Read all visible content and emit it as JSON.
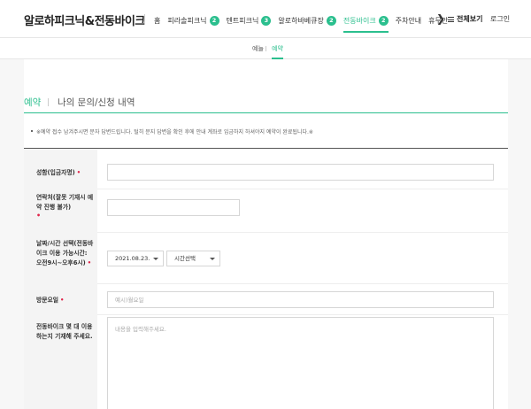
{
  "header": {
    "logo": "알로하피크닉&전동바이크",
    "nav": [
      {
        "label": "홈",
        "badge": ""
      },
      {
        "label": "피라솔피크닉",
        "badge": "2"
      },
      {
        "label": "텐트피크닉",
        "badge": "3"
      },
      {
        "label": "알로하바베큐장",
        "badge": "2"
      },
      {
        "label": "전동바이크",
        "badge": "2",
        "active": true
      },
      {
        "label": "주차안내",
        "badge": ""
      },
      {
        "label": "휴무안",
        "badge": ""
      }
    ],
    "arrow": "❯",
    "menu_all": "전체보기",
    "login": "로그인"
  },
  "subnav": {
    "items": [
      "예늘",
      "예약"
    ]
  },
  "tabs": {
    "active": "예약",
    "other": "나의 문의/신청 내역"
  },
  "notice": "※예약 접수 남겨주시면 문자 답변드립니다. 털히 문지 답변을 확인 후에 안내 계좌로 입금하지 하셔야지 예약이 완료됩니다.※",
  "form": {
    "name_label": "성함(입금자명)",
    "contact_label": "연락처(잘못 기재시 예약 진행 불가)",
    "datetime_label": "날짜/시간 선택(전동바이크 이용 가능시간: 오전9시~오후6시)",
    "date_value": "2021.08.23.",
    "time_value": "시간선택",
    "weekday_label": "방문요일",
    "weekday_placeholder": "예시)월요일",
    "usage_label": "전동바이크 몇 대 이용하는지 기재해 주세요.",
    "usage_placeholder": "내용을 입력해주세요.",
    "required_mark": "•"
  },
  "colors": {
    "accent": "#2bbf8e",
    "required": "#e0264b"
  }
}
